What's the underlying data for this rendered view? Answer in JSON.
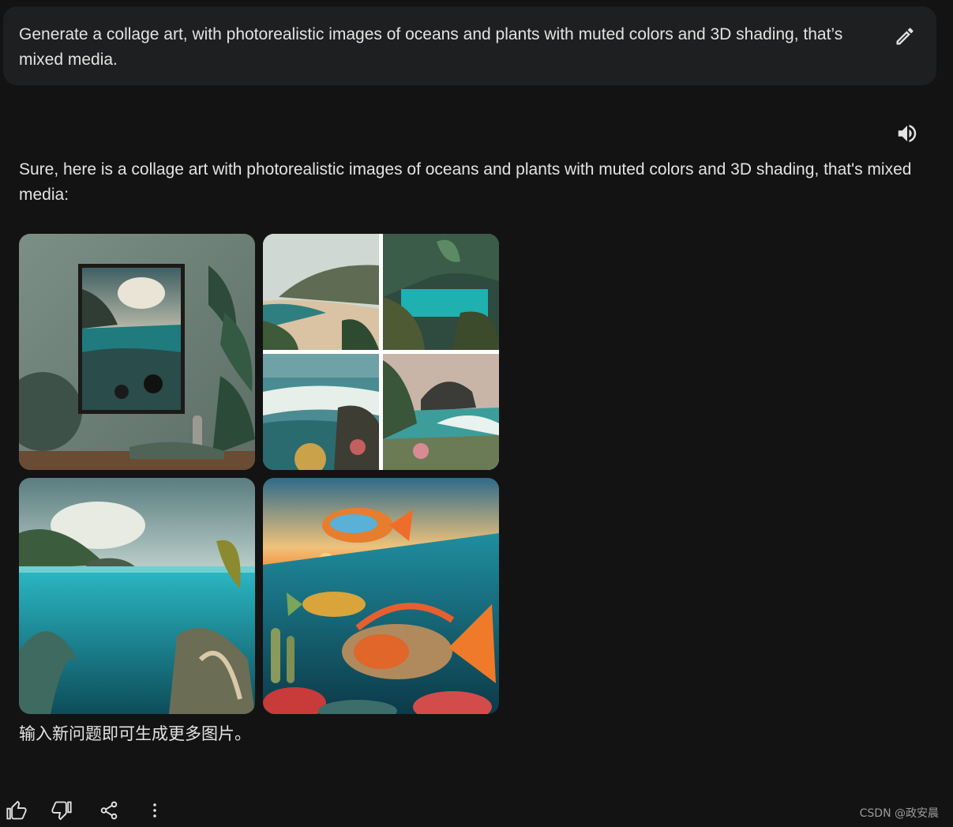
{
  "prompt": {
    "text": "Generate a collage art, with photorealistic images of oceans and plants with muted colors and 3D shading, that’s mixed media.",
    "edit_icon": "pencil-icon"
  },
  "response": {
    "speaker_icon": "volume-icon",
    "text": "Sure, here is a collage art with photorealistic images of oceans and plants with muted colors and 3D shading, that's mixed media:",
    "images": [
      {
        "subject": "framed ocean painting on wall with plants"
      },
      {
        "subject": "four-panel collage of coastal scenes"
      },
      {
        "subject": "split view ocean surface and underwater plants"
      },
      {
        "subject": "colorful fish underwater at sunset"
      }
    ],
    "followup": "输入新问题即可生成更多图片。"
  },
  "actions": {
    "thumbs_up_icon": "thumbs-up-icon",
    "thumbs_down_icon": "thumbs-down-icon",
    "share_icon": "share-icon",
    "more_icon": "more-vert-icon"
  },
  "watermark": "CSDN @政安晨",
  "colors": {
    "background": "#131314",
    "card": "#1e1f20",
    "text": "#e3e3e3"
  }
}
